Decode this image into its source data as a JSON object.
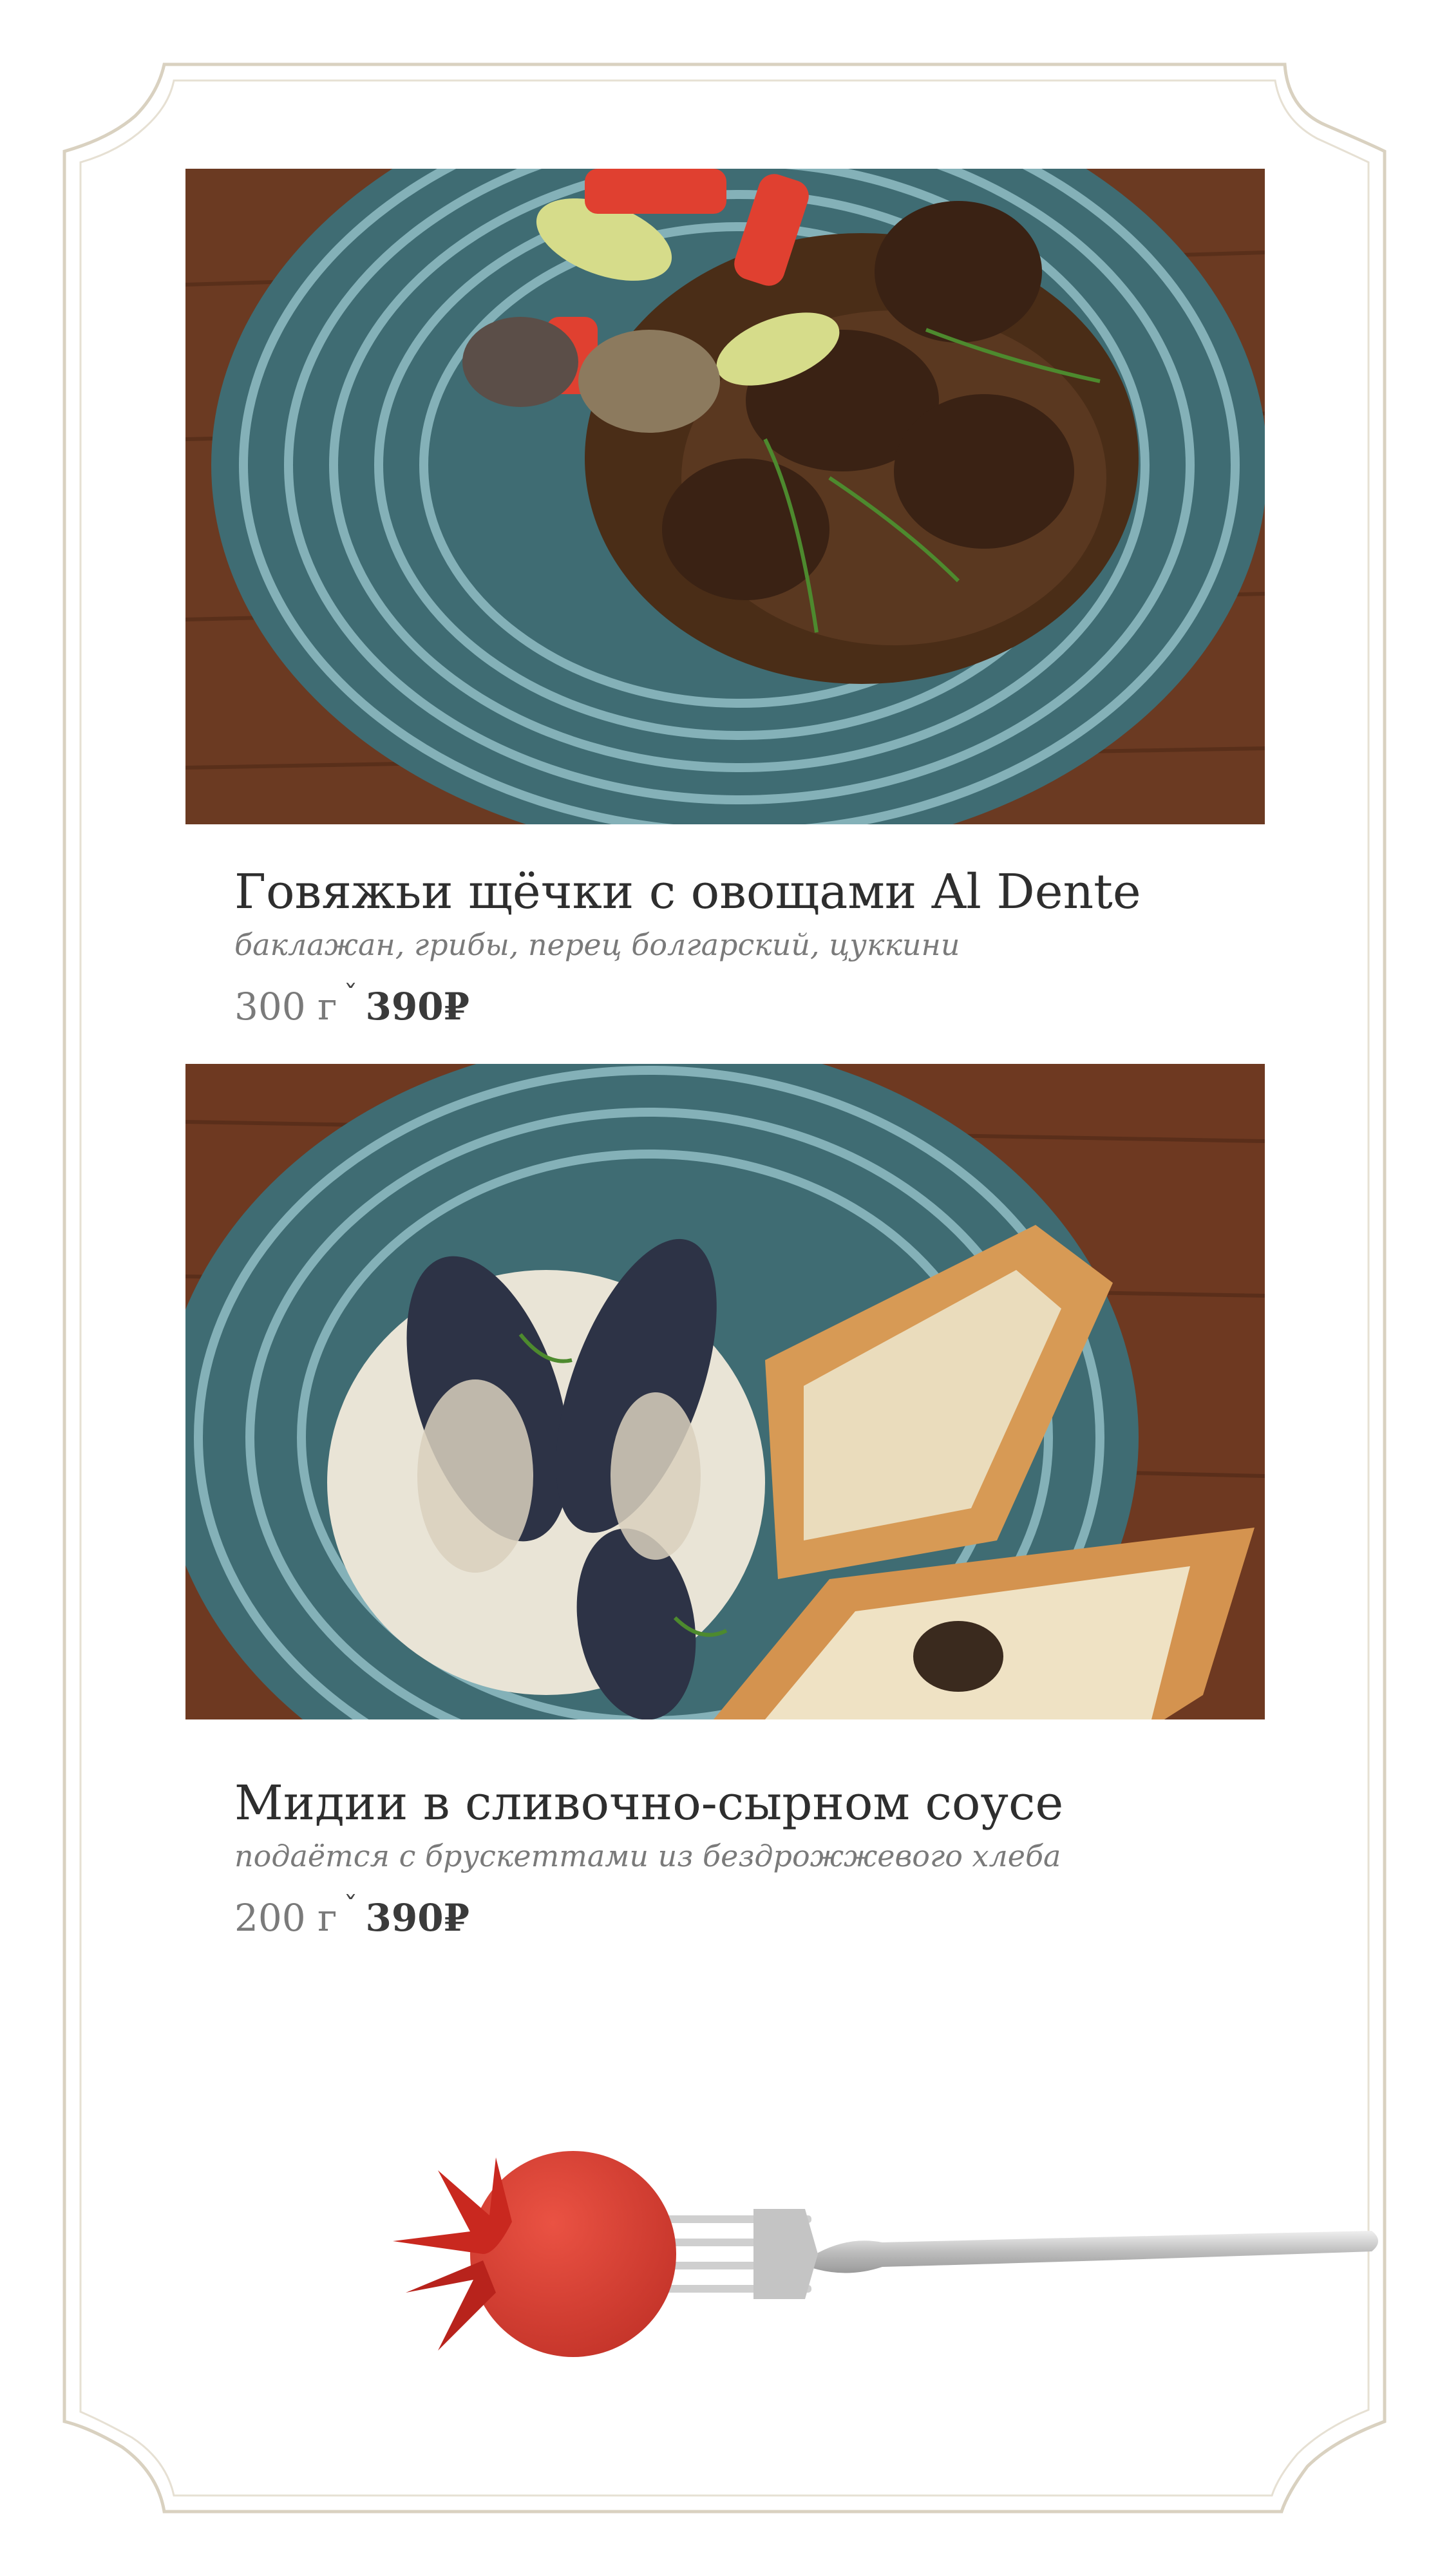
{
  "dishes": [
    {
      "title": "Говяжьи щёчки с овощами Al Dente",
      "description": "баклажан, грибы, перец болгарский,  цуккини",
      "weight": "300 г",
      "separator": "ˇ",
      "price": "390₽"
    },
    {
      "title": "Мидии в сливочно-сырном соусе",
      "description": "подаётся с брускеттами из бездрожжевого хлеба",
      "weight": "200 г",
      "separator": "ˇ",
      "price": "390₽"
    }
  ],
  "colors": {
    "frame": "#d9d1c0",
    "title": "#2e2e2e",
    "muted": "#7a7a7a",
    "tomato": "#d93b2f",
    "plate": "#7fb2bf",
    "wood": "#6b3a22"
  },
  "icons": [
    "tomato-on-fork-illustration"
  ]
}
